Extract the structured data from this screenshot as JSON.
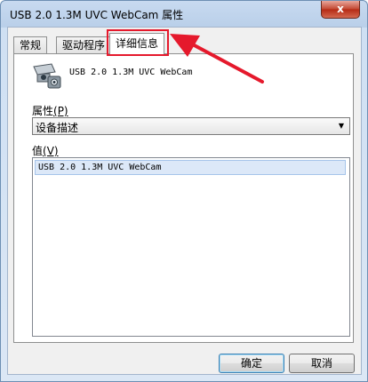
{
  "window": {
    "title": "USB 2.0 1.3M UVC WebCam 属性",
    "close_glyph": "x"
  },
  "tabs": [
    {
      "label": "常规",
      "active": false
    },
    {
      "label": "驱动程序",
      "active": false
    },
    {
      "label": "详细信息",
      "active": true
    }
  ],
  "device": {
    "name": "USB 2.0 1.3M UVC WebCam",
    "icon": "webcam-icon"
  },
  "property": {
    "label": "属性",
    "accelerator": "(P)",
    "selected": "设备描述"
  },
  "value": {
    "label": "值",
    "accelerator": "(V)",
    "items": [
      "USB 2.0 1.3M UVC WebCam"
    ]
  },
  "buttons": {
    "ok": "确定",
    "cancel": "取消"
  },
  "annotation": {
    "color": "#e5192c"
  }
}
